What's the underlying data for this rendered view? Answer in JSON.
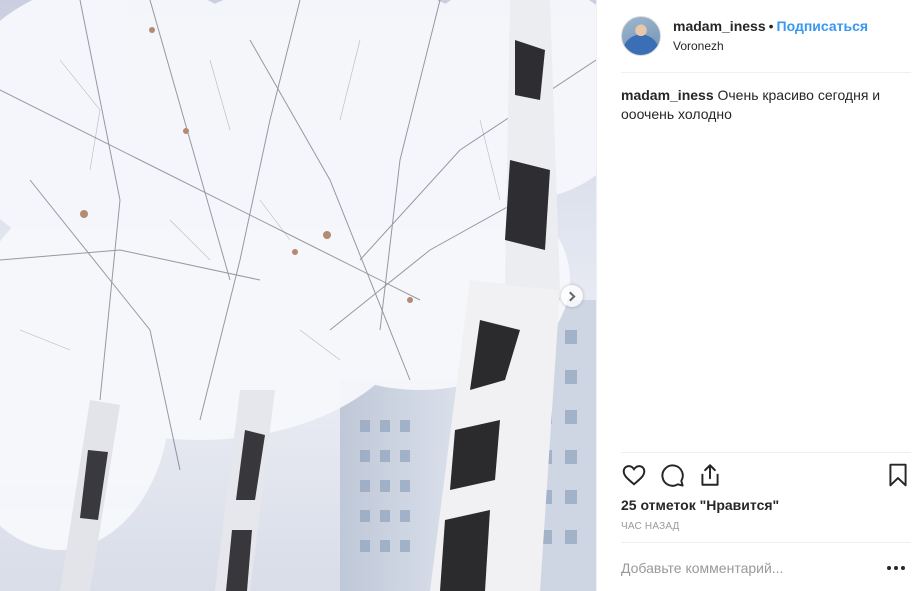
{
  "post": {
    "username": "madam_iness",
    "separator": "•",
    "follow_label": "Подписаться",
    "location": "Voronezh",
    "caption_user": "madam_iness",
    "caption_text": "Очень красиво сегодня и ооочень холодно",
    "likes_text": "25 отметок \"Нравится\"",
    "time_text": "час назад"
  },
  "comment": {
    "placeholder": "Добавьте комментарий..."
  },
  "icons": {
    "like": "heart-icon",
    "comment": "comment-icon",
    "share": "share-icon",
    "save": "bookmark-icon",
    "next": "chevron-right-icon",
    "more": "more-icon"
  },
  "colors": {
    "accent": "#3897f0",
    "text": "#262626",
    "muted": "#999999"
  }
}
